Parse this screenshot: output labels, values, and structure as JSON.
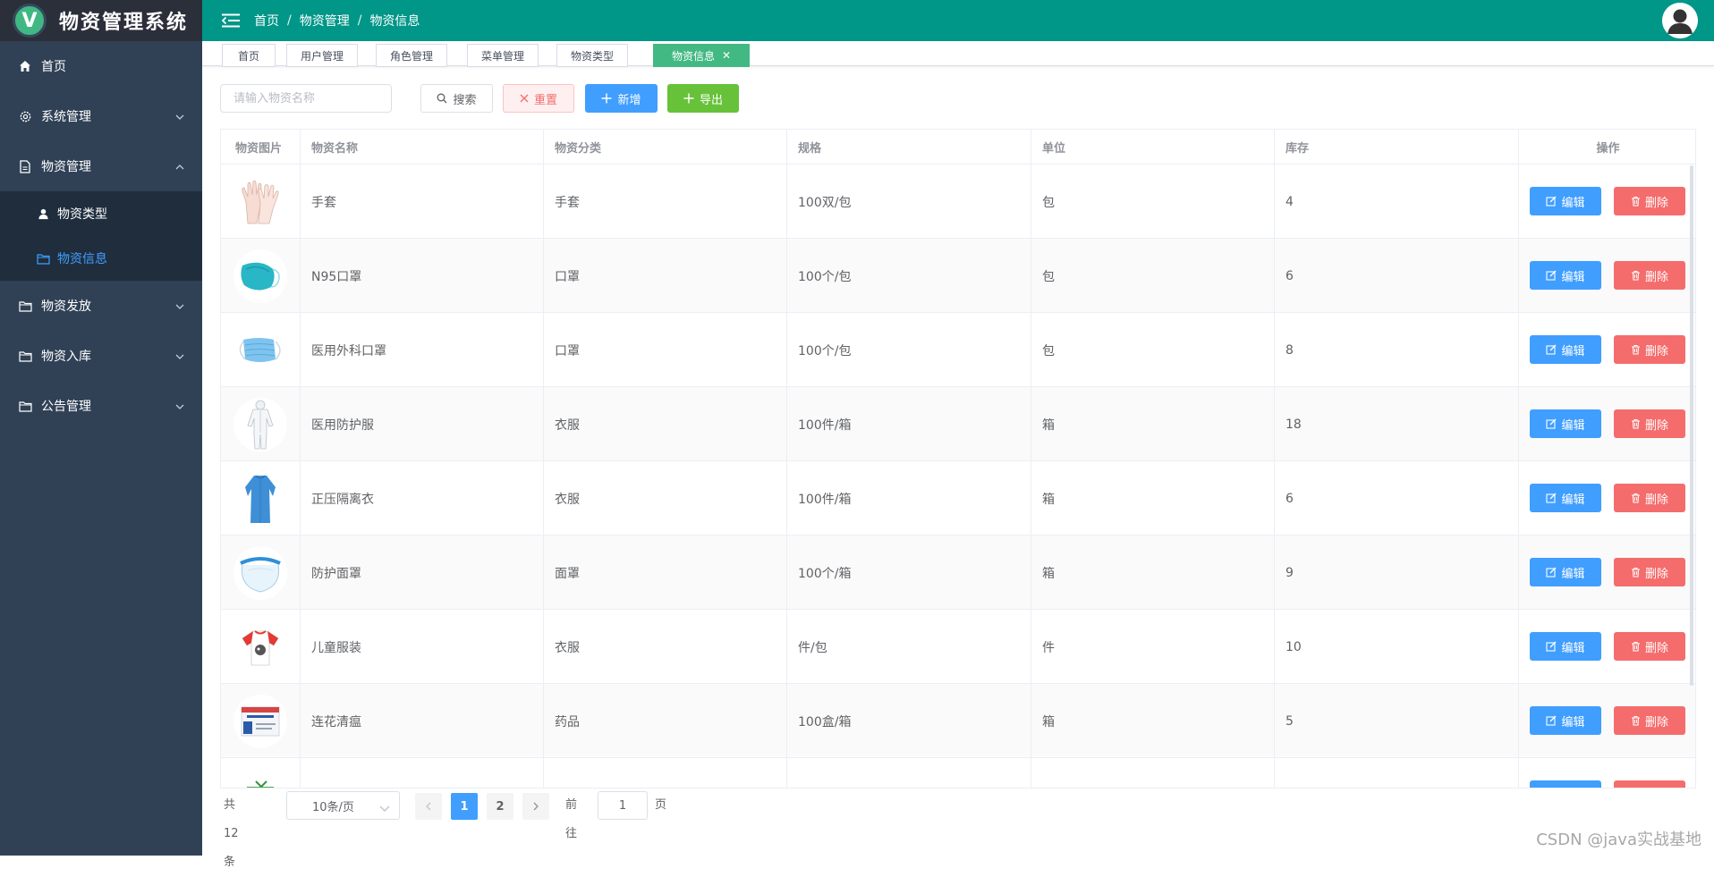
{
  "app": {
    "logo_letter": "V",
    "title": "物资管理系统"
  },
  "colors": {
    "sidebar_bg": "#304156",
    "header_bg": "#009688",
    "active_tag": "#42b983",
    "primary": "#409eff",
    "danger": "#f56c6c",
    "success": "#67c23a"
  },
  "sidebar": {
    "items": [
      {
        "label": "首页",
        "icon": "home-icon"
      },
      {
        "label": "系统管理",
        "icon": "gear-icon"
      },
      {
        "label": "物资管理",
        "icon": "document-icon"
      },
      {
        "label": "物资类型",
        "icon": "user-icon"
      },
      {
        "label": "物资信息",
        "icon": "folder-icon"
      },
      {
        "label": "物资发放",
        "icon": "folder-icon"
      },
      {
        "label": "物资入库",
        "icon": "folder-icon"
      },
      {
        "label": "公告管理",
        "icon": "folder-icon"
      }
    ]
  },
  "header": {
    "breadcrumb": [
      "首页",
      "物资管理",
      "物资信息"
    ]
  },
  "tags": [
    "首页",
    "用户管理",
    "角色管理",
    "菜单管理",
    "物资类型",
    "物资信息"
  ],
  "toolbar": {
    "search_placeholder": "请输入物资名称",
    "search_label": "搜索",
    "reset_label": "重置",
    "add_label": "新增",
    "export_label": "导出"
  },
  "table": {
    "columns": [
      "物资图片",
      "物资名称",
      "物资分类",
      "规格",
      "单位",
      "库存",
      "操作"
    ],
    "edit_label": "编辑",
    "delete_label": "删除",
    "rows": [
      {
        "name": "手套",
        "category": "手套",
        "spec": "100双/包",
        "unit": "包",
        "stock": "4",
        "image": "gloves-image"
      },
      {
        "name": "N95口罩",
        "category": "口罩",
        "spec": "100个/包",
        "unit": "包",
        "stock": "6",
        "image": "n95-mask-image"
      },
      {
        "name": "医用外科口罩",
        "category": "口罩",
        "spec": "100个/包",
        "unit": "包",
        "stock": "8",
        "image": "surgical-mask-image"
      },
      {
        "name": "医用防护服",
        "category": "衣服",
        "spec": "100件/箱",
        "unit": "箱",
        "stock": "18",
        "image": "protective-suit-image"
      },
      {
        "name": "正压隔离衣",
        "category": "衣服",
        "spec": "100件/箱",
        "unit": "箱",
        "stock": "6",
        "image": "isolation-gown-image"
      },
      {
        "name": "防护面罩",
        "category": "面罩",
        "spec": "100个/箱",
        "unit": "箱",
        "stock": "9",
        "image": "face-shield-image"
      },
      {
        "name": "儿童服装",
        "category": "衣服",
        "spec": "件/包",
        "unit": "件",
        "stock": "10",
        "image": "kids-shirt-image"
      },
      {
        "name": "连花清瘟",
        "category": "药品",
        "spec": "100盒/箱",
        "unit": "箱",
        "stock": "5",
        "image": "medicine-box-image"
      },
      {
        "name": "",
        "category": "",
        "spec": "",
        "unit": "",
        "stock": "",
        "image": "green-package-image"
      }
    ]
  },
  "pagination": {
    "total_text": "共 12 条",
    "page_size": "10条/页",
    "pages": [
      "1",
      "2"
    ],
    "current_page": "1",
    "goto_label": "前往",
    "goto_value": "1",
    "page_suffix": "页"
  },
  "watermark": "CSDN @java实战基地"
}
